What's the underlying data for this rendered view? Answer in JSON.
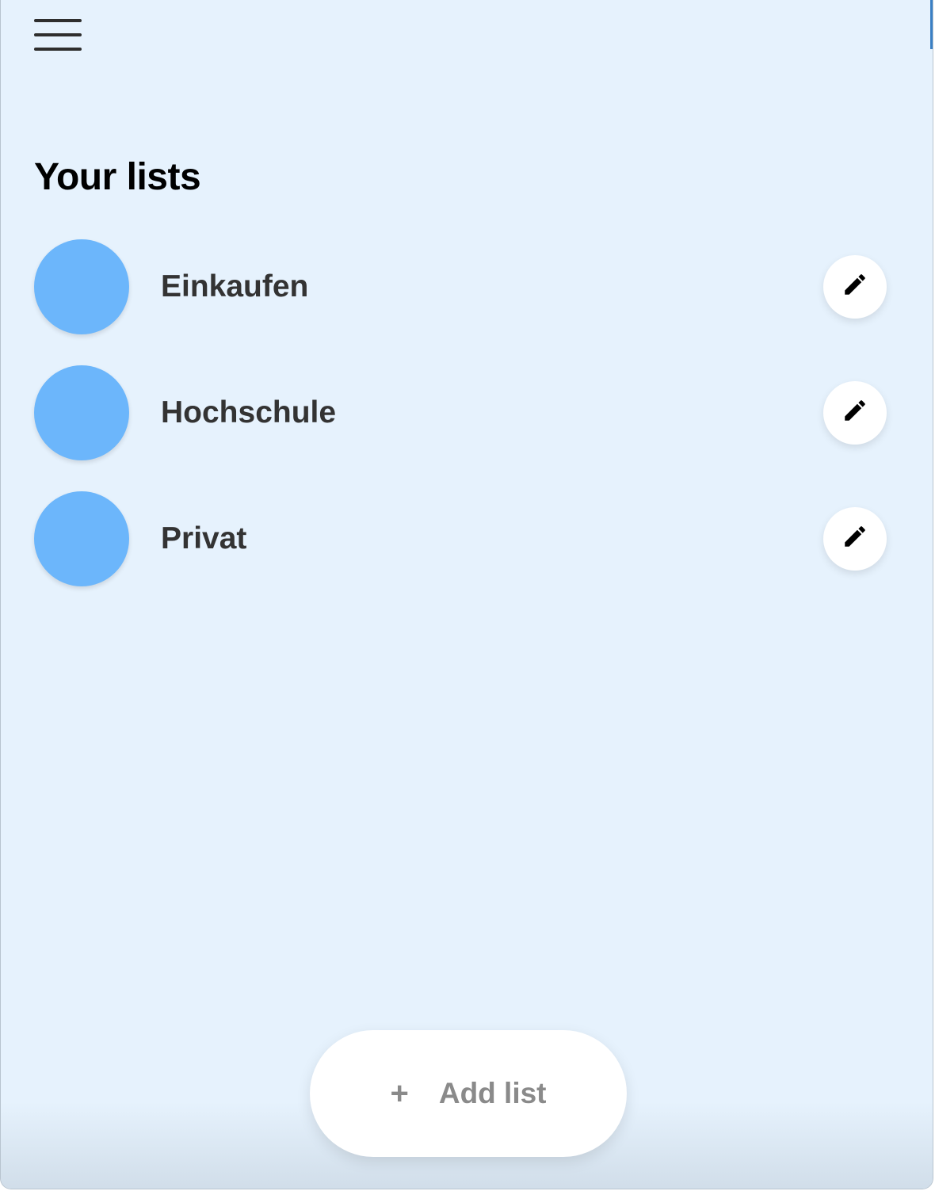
{
  "header": {
    "menu_icon": "hamburger-menu-icon"
  },
  "main": {
    "title": "Your lists",
    "lists": [
      {
        "name": "Einkaufen",
        "color": "#6cb6fb",
        "edit_icon": "pencil-icon"
      },
      {
        "name": "Hochschule",
        "color": "#6cb6fb",
        "edit_icon": "pencil-icon"
      },
      {
        "name": "Privat",
        "color": "#6cb6fb",
        "edit_icon": "pencil-icon"
      }
    ]
  },
  "footer": {
    "add_icon": "+",
    "add_label": "Add list"
  },
  "colors": {
    "background": "#e6f2fd",
    "accent": "#6cb6fb",
    "title_text": "#000000",
    "item_text": "#333333",
    "add_text": "#8a8a8a"
  }
}
